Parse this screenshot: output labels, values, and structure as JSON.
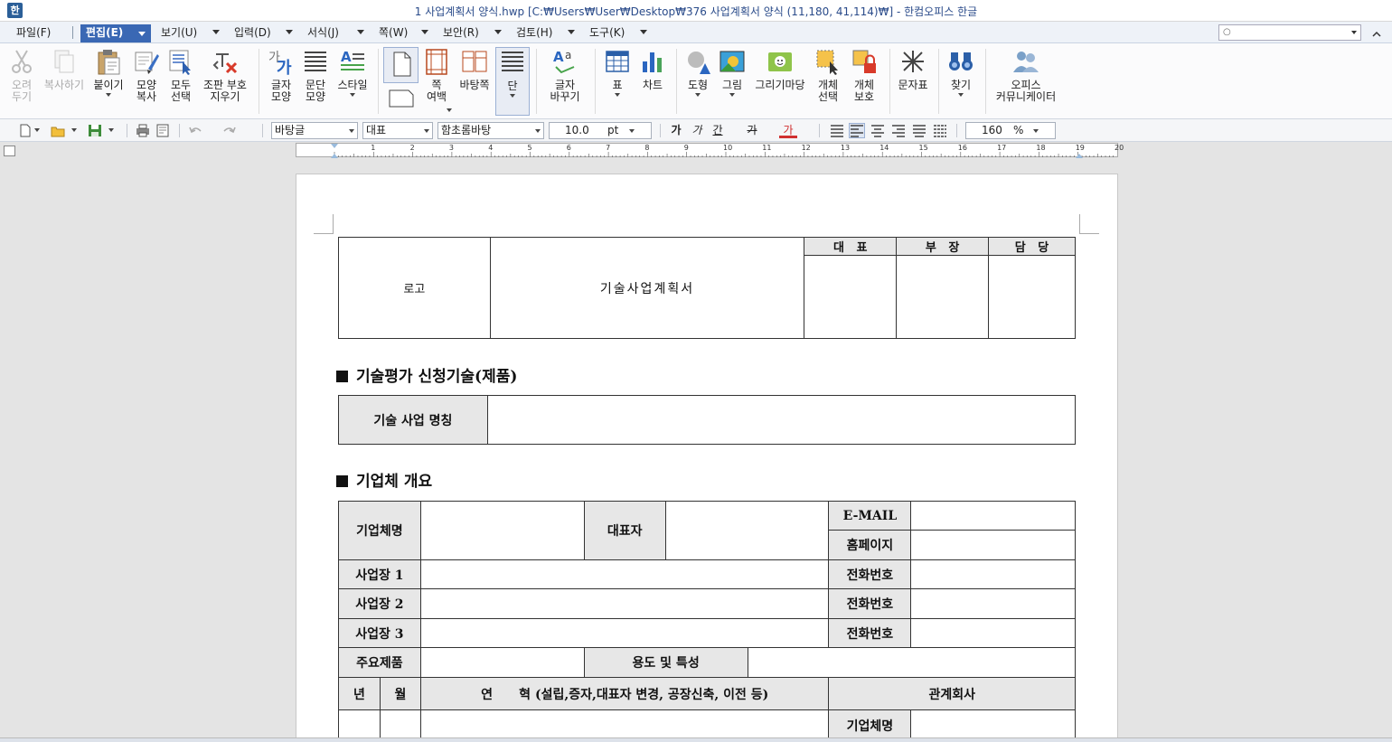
{
  "window": {
    "title": "1 사업계획서 양식.hwp [C:₩Users₩User₩Desktop₩376 사업계획서 양식 (11,180, 41,114)₩] - 한컴오피스 한글"
  },
  "menu": {
    "items": [
      {
        "label": "파일(F)"
      },
      {
        "label": "편집(E)"
      },
      {
        "label": "보기(U)"
      },
      {
        "label": "입력(D)"
      },
      {
        "label": "서식(J)"
      },
      {
        "label": "쪽(W)"
      },
      {
        "label": "보안(R)"
      },
      {
        "label": "검토(H)"
      },
      {
        "label": "도구(K)"
      }
    ],
    "search_value": "○"
  },
  "ribbon": {
    "cut": "오려\n두기",
    "copy": "복사하기",
    "paste": "붙이기",
    "format_copy": "모양\n복사",
    "select_all": "모두\n선택",
    "clear_marks": "조판 부호\n지우기",
    "char_shape": "글자\n모양",
    "para_shape": "문단\n모양",
    "style": "스타일",
    "page_margin": "쪽\n여백",
    "background_page": "바탕쪽",
    "column": "단",
    "char_replace": "글자\n바꾸기",
    "table": "표",
    "chart": "차트",
    "shape": "도형",
    "picture": "그림",
    "drawing_market": "그리기마당",
    "object_select": "개체\n선택",
    "object_protect": "개체\n보호",
    "symbol": "문자표",
    "find": "찾기",
    "office_community": "오피스\n커뮤니케이터"
  },
  "format": {
    "style": "바탕글",
    "lang": "대표",
    "font": "함초롬바탕",
    "size": "10.0",
    "unit": "pt",
    "zoom": "160",
    "zoom_unit": "%",
    "bold": "가",
    "italic": "가",
    "underline": "간",
    "strike": "가",
    "color": "가"
  },
  "ruler": {
    "numbers": [
      "1",
      "2",
      "3",
      "4",
      "5",
      "6",
      "7",
      "8",
      "9",
      "10",
      "11",
      "12",
      "13",
      "14",
      "15",
      "16",
      "17",
      "18",
      "19",
      "20"
    ]
  },
  "document": {
    "header": {
      "logo": "로고",
      "title": "기술사업계획서",
      "approvals": [
        "대   표",
        "부   장",
        "담   당"
      ]
    },
    "section1": {
      "heading": "기술평가 신청기술(제품)",
      "label": "기술 사업 명칭"
    },
    "section2": {
      "heading": "기업체 개요",
      "company_name": "기업체명",
      "ceo": "대표자",
      "email": "E-MAIL",
      "homepage": "홈페이지",
      "site1": "사업장 1",
      "site2": "사업장 2",
      "site3": "사업장 3",
      "phone": "전화번호",
      "main_product": "주요제품",
      "usage": "용도 및 특성",
      "year": "년",
      "month": "월",
      "history": "연      혁 (설립,증자,대표자 변경, 공장신축, 이전 등)",
      "related_company": "관계회사",
      "related_name": "기업체명"
    }
  }
}
